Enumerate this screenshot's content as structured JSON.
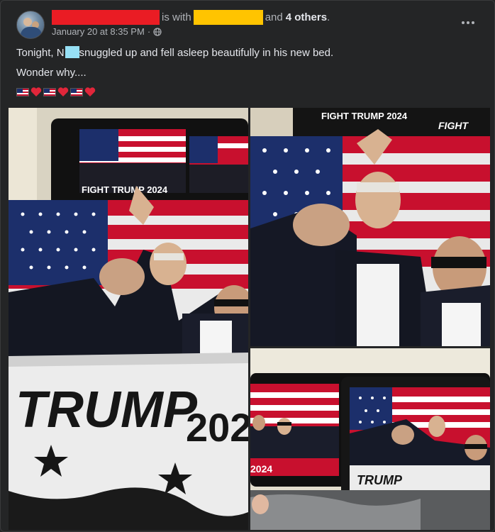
{
  "post": {
    "author_redacted": "",
    "is_with": "is with",
    "tagged_redacted": "",
    "and": "and",
    "others": "4 others",
    "period": ".",
    "timestamp": "January 20 at 8:35 PM",
    "separator": "·",
    "audience_icon": "globe-icon",
    "more_icon": "more-options-icon"
  },
  "body": {
    "line1_before": "Tonight, N",
    "line1_after": "snuggled up and fell asleep beautifully in his new bed.",
    "line2": "Wonder why....",
    "emojis": [
      "us-flag",
      "red-heart",
      "us-flag",
      "red-heart",
      "us-flag",
      "red-heart"
    ]
  },
  "photos": {
    "text_trump": "TRUMP",
    "text_year": "2024",
    "text_fight": "FIGHT",
    "pillow_text": "FIGHT TRUMP 2024"
  },
  "colors": {
    "background": "#242526",
    "primary_text": "#e4e6eb",
    "secondary_text": "#b0b3b8",
    "redact_red": "#ea1c24",
    "redact_yellow": "#ffc400",
    "redact_cyan": "#96e0f5",
    "flag_red": "#c8102e",
    "flag_blue": "#1c2f6b"
  }
}
